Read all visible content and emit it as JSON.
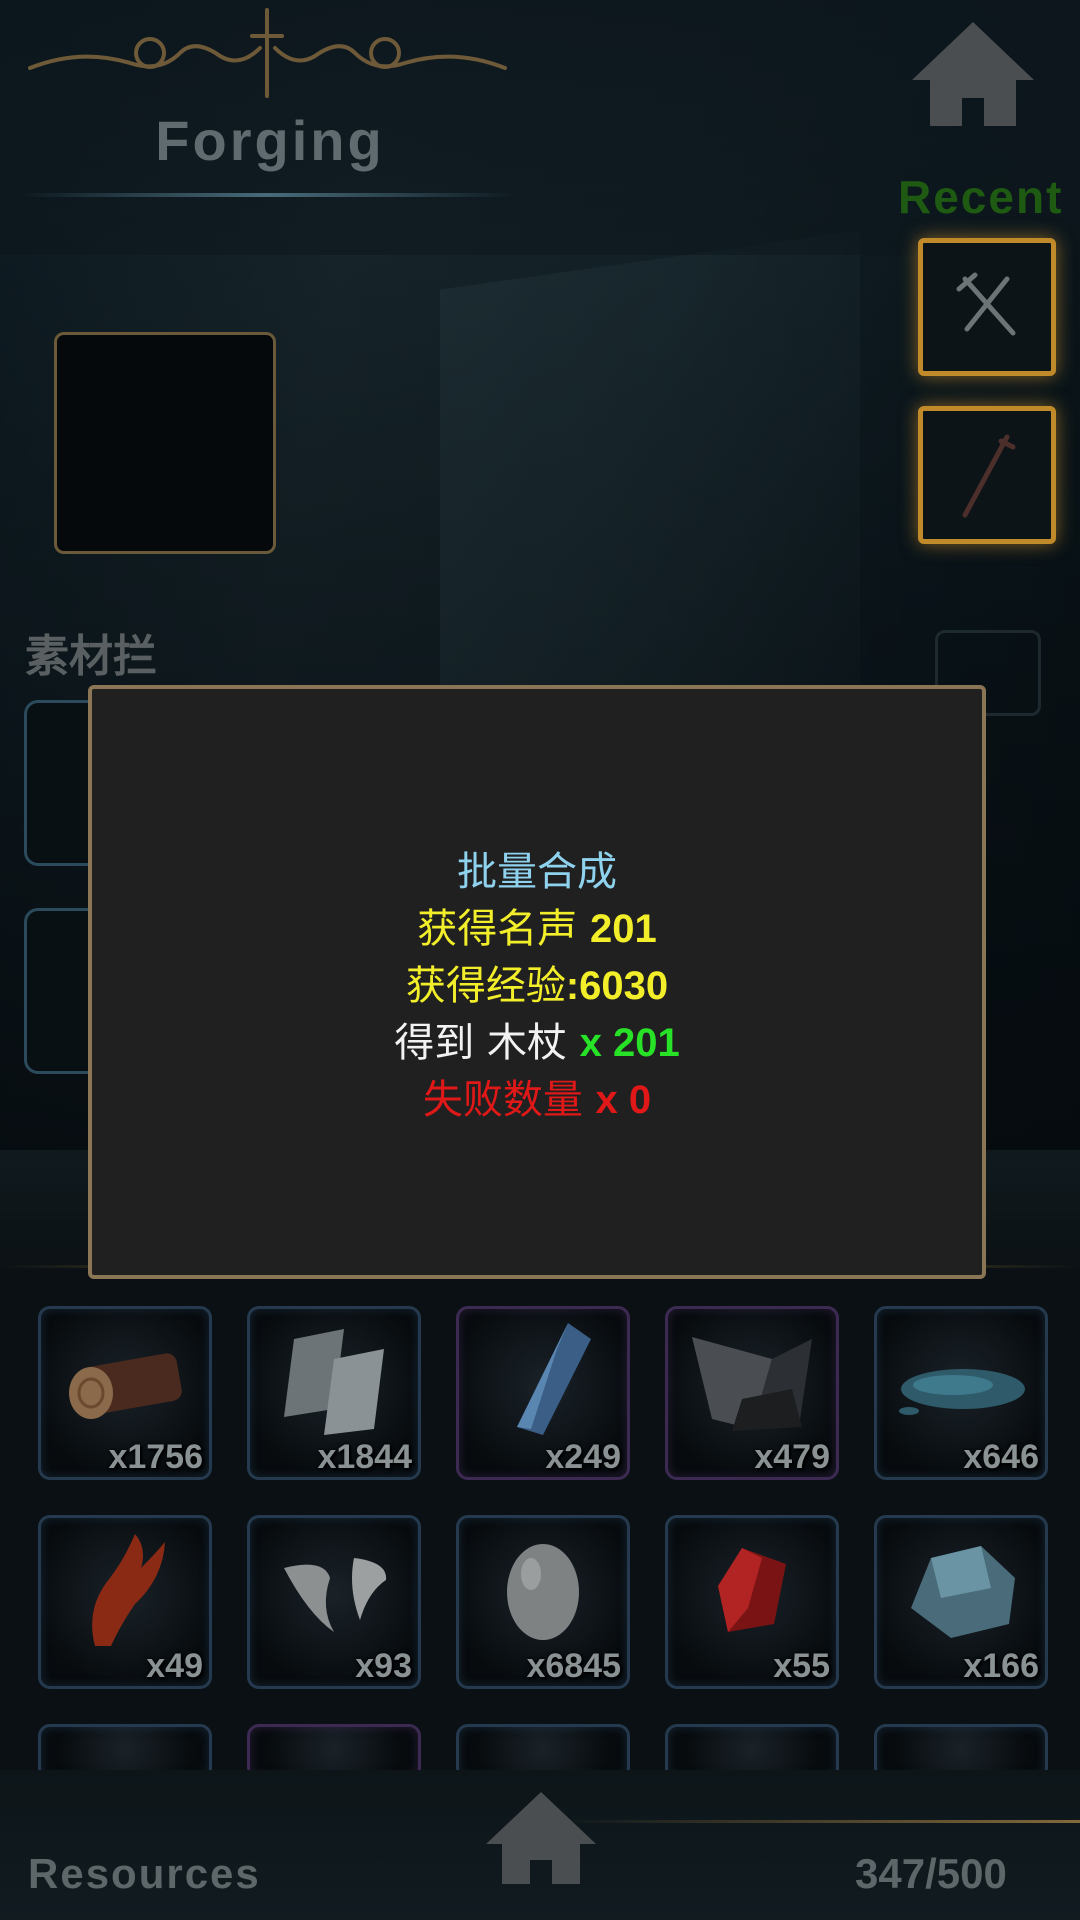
{
  "header": {
    "title": "Forging",
    "recent_label": "Recent"
  },
  "workspace": {
    "section_label": "素材拦"
  },
  "dialog": {
    "title": "批量合成",
    "fame_label": "获得名声",
    "fame_value": "201",
    "exp_label": "获得经验",
    "exp_value": ":6030",
    "item_label": "得到",
    "item_name": "木杖",
    "item_count": "x 201",
    "fail_label": "失败数量",
    "fail_count": "x 0"
  },
  "inventory": {
    "items": [
      {
        "icon": "wood-log-icon",
        "count": "x1756",
        "rarity": "blue"
      },
      {
        "icon": "metal-plates-icon",
        "count": "x1844",
        "rarity": "blue"
      },
      {
        "icon": "blue-crystal-icon",
        "count": "x249",
        "rarity": "purple"
      },
      {
        "icon": "dark-crystal-cluster-icon",
        "count": "x479",
        "rarity": "purple"
      },
      {
        "icon": "water-puddle-icon",
        "count": "x646",
        "rarity": "blue"
      },
      {
        "icon": "red-claw-icon",
        "count": "x49",
        "rarity": "blue"
      },
      {
        "icon": "fangs-icon",
        "count": "x93",
        "rarity": "blue"
      },
      {
        "icon": "egg-icon",
        "count": "x6845",
        "rarity": "blue"
      },
      {
        "icon": "red-gem-icon",
        "count": "x55",
        "rarity": "blue"
      },
      {
        "icon": "blue-ore-icon",
        "count": "x166",
        "rarity": "blue"
      }
    ]
  },
  "footer": {
    "resources_label": "Resources",
    "capacity": "347/500"
  },
  "colors": {
    "dialog_title": "#8fd2ee",
    "fame": "#f2ee2a",
    "item_count": "#27e227",
    "fail": "#e01818",
    "recent_border": "#c08a2a"
  }
}
